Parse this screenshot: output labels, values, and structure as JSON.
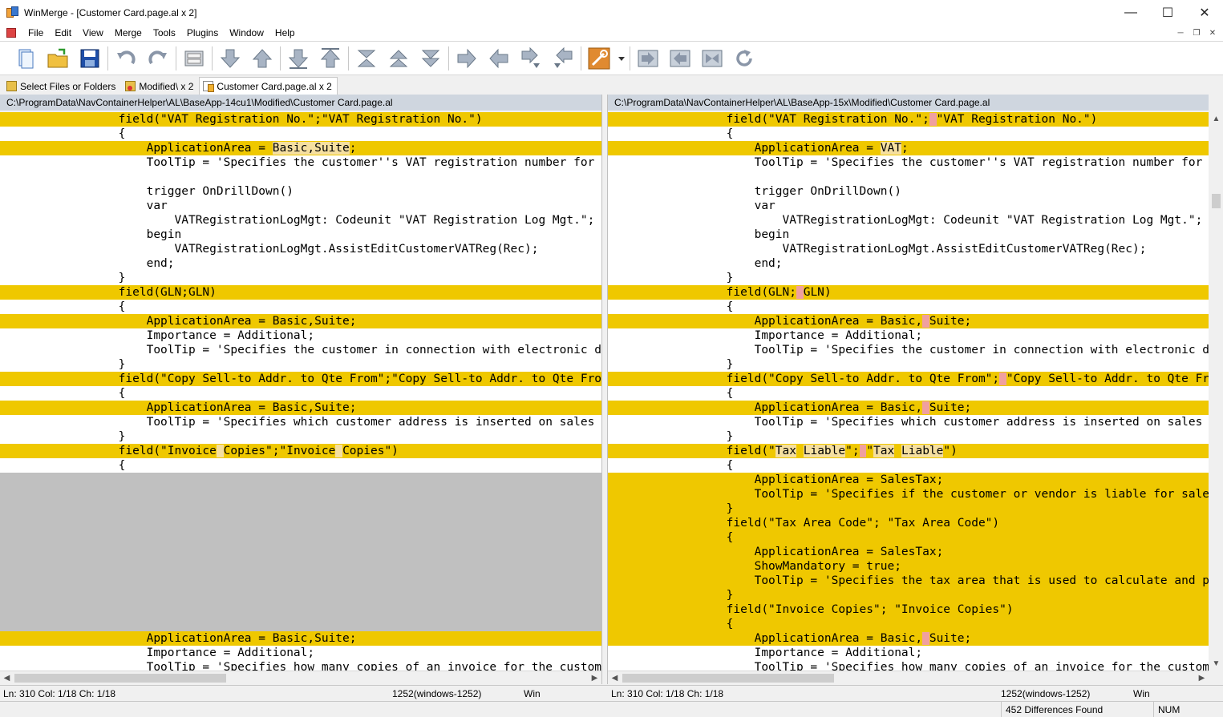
{
  "window": {
    "title": "WinMerge - [Customer Card.page.al x 2]"
  },
  "menu": [
    "File",
    "Edit",
    "View",
    "Merge",
    "Tools",
    "Plugins",
    "Window",
    "Help"
  ],
  "toolbar_icons": [
    "new-icon",
    "open-icon",
    "save-icon",
    "undo-icon",
    "redo-icon",
    "compare-icon",
    "next-diff-icon",
    "prev-diff-icon",
    "first-diff-icon",
    "last-diff-icon",
    "current-diff-icon",
    "prev-conflict-icon",
    "next-conflict-icon",
    "copy-right-icon",
    "copy-left-icon",
    "copy-right-advance-icon",
    "copy-left-advance-icon",
    "options-icon",
    "copy-all-right-icon",
    "copy-all-left-icon",
    "collapse-icon",
    "refresh-icon"
  ],
  "tabs": [
    {
      "label": "Select Files or Folders",
      "icon": "folder-icon",
      "active": false
    },
    {
      "label": "Modified\\ x 2",
      "icon": "folder-diff-icon",
      "active": false
    },
    {
      "label": "Customer Card.page.al x 2",
      "icon": "file-diff-icon",
      "active": true
    }
  ],
  "left": {
    "path": "C:\\ProgramData\\NavContainerHelper\\AL\\BaseApp-14cu1\\Modified\\Customer Card.page.al",
    "status": {
      "pos": "Ln: 310  Col: 1/18  Ch: 1/18",
      "encoding": "1252(windows-1252)",
      "eol": "Win"
    },
    "lines": [
      {
        "t": "diff",
        "segs": [
          {
            "s": "                field(\"VAT Registration No.\";\"VAT Registration No.\")"
          }
        ]
      },
      {
        "t": "",
        "segs": [
          {
            "s": "                {"
          }
        ]
      },
      {
        "t": "diff",
        "segs": [
          {
            "s": "                    ApplicationArea = "
          },
          {
            "s": "Basic,Suite",
            "h": "hl"
          },
          {
            "s": ";"
          }
        ]
      },
      {
        "t": "",
        "segs": [
          {
            "s": "                    ToolTip = 'Specifies the customer''s VAT registration number for customers in EU countries/regions.';"
          }
        ]
      },
      {
        "t": "",
        "segs": [
          {
            "s": ""
          }
        ]
      },
      {
        "t": "",
        "segs": [
          {
            "s": "                    trigger OnDrillDown()"
          }
        ]
      },
      {
        "t": "",
        "segs": [
          {
            "s": "                    var"
          }
        ]
      },
      {
        "t": "",
        "segs": [
          {
            "s": "                        VATRegistrationLogMgt: Codeunit \"VAT Registration Log Mgt.\";"
          }
        ]
      },
      {
        "t": "",
        "segs": [
          {
            "s": "                    begin"
          }
        ]
      },
      {
        "t": "",
        "segs": [
          {
            "s": "                        VATRegistrationLogMgt.AssistEditCustomerVATReg(Rec);"
          }
        ]
      },
      {
        "t": "",
        "segs": [
          {
            "s": "                    end;"
          }
        ]
      },
      {
        "t": "",
        "segs": [
          {
            "s": "                }"
          }
        ]
      },
      {
        "t": "diff",
        "segs": [
          {
            "s": "                field(GLN;GLN)"
          }
        ]
      },
      {
        "t": "",
        "segs": [
          {
            "s": "                {"
          }
        ]
      },
      {
        "t": "diff",
        "segs": [
          {
            "s": "                    ApplicationArea = Basic,Suite;"
          }
        ]
      },
      {
        "t": "",
        "segs": [
          {
            "s": "                    Importance = Additional;"
          }
        ]
      },
      {
        "t": "",
        "segs": [
          {
            "s": "                    ToolTip = 'Specifies the customer in connection with electronic document sending.';"
          }
        ]
      },
      {
        "t": "",
        "segs": [
          {
            "s": "                }"
          }
        ]
      },
      {
        "t": "diff",
        "segs": [
          {
            "s": "                field(\"Copy Sell-to Addr. to Qte From\";\"Copy Sell-to Addr. to Qte From\")"
          }
        ]
      },
      {
        "t": "",
        "segs": [
          {
            "s": "                {"
          }
        ]
      },
      {
        "t": "diff",
        "segs": [
          {
            "s": "                    ApplicationArea = Basic,Suite;"
          }
        ]
      },
      {
        "t": "",
        "segs": [
          {
            "s": "                    ToolTip = 'Specifies which customer address is inserted on sales quotes that you create for the customer.';"
          }
        ]
      },
      {
        "t": "",
        "segs": [
          {
            "s": "                }"
          }
        ]
      },
      {
        "t": "diff",
        "segs": [
          {
            "s": "                field(\"Invoice"
          },
          {
            "s": " ",
            "h": "hl"
          },
          {
            "s": "Copies\";\"Invoice"
          },
          {
            "s": " ",
            "h": "hl"
          },
          {
            "s": "Copies\")"
          }
        ]
      },
      {
        "t": "",
        "segs": [
          {
            "s": "                {"
          }
        ]
      },
      {
        "t": "blank",
        "segs": [
          {
            "s": ""
          }
        ]
      },
      {
        "t": "blank",
        "segs": [
          {
            "s": ""
          }
        ]
      },
      {
        "t": "blank",
        "segs": [
          {
            "s": ""
          }
        ]
      },
      {
        "t": "blank",
        "segs": [
          {
            "s": ""
          }
        ]
      },
      {
        "t": "blank",
        "segs": [
          {
            "s": ""
          }
        ]
      },
      {
        "t": "blank",
        "segs": [
          {
            "s": ""
          }
        ]
      },
      {
        "t": "blank",
        "segs": [
          {
            "s": ""
          }
        ]
      },
      {
        "t": "blank",
        "segs": [
          {
            "s": ""
          }
        ]
      },
      {
        "t": "blank",
        "segs": [
          {
            "s": ""
          }
        ]
      },
      {
        "t": "blank",
        "segs": [
          {
            "s": ""
          }
        ]
      },
      {
        "t": "blank",
        "segs": [
          {
            "s": ""
          }
        ]
      },
      {
        "t": "diff",
        "segs": [
          {
            "s": "                    ApplicationArea = Basic,Suite;"
          }
        ]
      },
      {
        "t": "",
        "segs": [
          {
            "s": "                    Importance = Additional;"
          }
        ]
      },
      {
        "t": "",
        "segs": [
          {
            "s": "                    ToolTip = 'Specifies how many copies of an invoice for the customer will be printed at a time.';"
          }
        ]
      }
    ]
  },
  "right": {
    "path": "C:\\ProgramData\\NavContainerHelper\\AL\\BaseApp-15x\\Modified\\Customer Card.page.al",
    "status": {
      "pos": "Ln: 310  Col: 1/18  Ch: 1/18",
      "encoding": "1252(windows-1252)",
      "eol": "Win"
    },
    "lines": [
      {
        "t": "diff",
        "segs": [
          {
            "s": "                field(\"VAT Registration No.\";"
          },
          {
            "s": " ",
            "h": "hl2"
          },
          {
            "s": "\"VAT Registration No.\")"
          }
        ]
      },
      {
        "t": "",
        "segs": [
          {
            "s": "                {"
          }
        ]
      },
      {
        "t": "diff",
        "segs": [
          {
            "s": "                    ApplicationArea = "
          },
          {
            "s": "VAT",
            "h": "hl"
          },
          {
            "s": ";"
          }
        ]
      },
      {
        "t": "",
        "segs": [
          {
            "s": "                    ToolTip = 'Specifies the customer''s VAT registration number for customers in EU countries/regions.';"
          }
        ]
      },
      {
        "t": "",
        "segs": [
          {
            "s": ""
          }
        ]
      },
      {
        "t": "",
        "segs": [
          {
            "s": "                    trigger OnDrillDown()"
          }
        ]
      },
      {
        "t": "",
        "segs": [
          {
            "s": "                    var"
          }
        ]
      },
      {
        "t": "",
        "segs": [
          {
            "s": "                        VATRegistrationLogMgt: Codeunit \"VAT Registration Log Mgt.\";"
          }
        ]
      },
      {
        "t": "",
        "segs": [
          {
            "s": "                    begin"
          }
        ]
      },
      {
        "t": "",
        "segs": [
          {
            "s": "                        VATRegistrationLogMgt.AssistEditCustomerVATReg(Rec);"
          }
        ]
      },
      {
        "t": "",
        "segs": [
          {
            "s": "                    end;"
          }
        ]
      },
      {
        "t": "",
        "segs": [
          {
            "s": "                }"
          }
        ]
      },
      {
        "t": "diff",
        "segs": [
          {
            "s": "                field(GLN;"
          },
          {
            "s": " ",
            "h": "hl2"
          },
          {
            "s": "GLN)"
          }
        ]
      },
      {
        "t": "",
        "segs": [
          {
            "s": "                {"
          }
        ]
      },
      {
        "t": "diff",
        "segs": [
          {
            "s": "                    ApplicationArea = Basic,"
          },
          {
            "s": " ",
            "h": "hl2"
          },
          {
            "s": "Suite;"
          }
        ]
      },
      {
        "t": "",
        "segs": [
          {
            "s": "                    Importance = Additional;"
          }
        ]
      },
      {
        "t": "",
        "segs": [
          {
            "s": "                    ToolTip = 'Specifies the customer in connection with electronic document sending.';"
          }
        ]
      },
      {
        "t": "",
        "segs": [
          {
            "s": "                }"
          }
        ]
      },
      {
        "t": "diff",
        "segs": [
          {
            "s": "                field(\"Copy Sell-to Addr. to Qte From\";"
          },
          {
            "s": " ",
            "h": "hl2"
          },
          {
            "s": "\"Copy Sell-to Addr. to Qte From\")"
          }
        ]
      },
      {
        "t": "",
        "segs": [
          {
            "s": "                {"
          }
        ]
      },
      {
        "t": "diff",
        "segs": [
          {
            "s": "                    ApplicationArea = Basic,"
          },
          {
            "s": " ",
            "h": "hl2"
          },
          {
            "s": "Suite;"
          }
        ]
      },
      {
        "t": "",
        "segs": [
          {
            "s": "                    ToolTip = 'Specifies which customer address is inserted on sales quotes that you create for the customer.';"
          }
        ]
      },
      {
        "t": "",
        "segs": [
          {
            "s": "                }"
          }
        ]
      },
      {
        "t": "diff",
        "segs": [
          {
            "s": "                field(\""
          },
          {
            "s": "Tax",
            "h": "hl"
          },
          {
            "s": " "
          },
          {
            "s": "Liable",
            "h": "hl"
          },
          {
            "s": "\";"
          },
          {
            "s": " ",
            "h": "hl2"
          },
          {
            "s": "\""
          },
          {
            "s": "Tax",
            "h": "hl"
          },
          {
            "s": " "
          },
          {
            "s": "Liable",
            "h": "hl"
          },
          {
            "s": "\")"
          }
        ]
      },
      {
        "t": "",
        "segs": [
          {
            "s": "                {"
          }
        ]
      },
      {
        "t": "diff",
        "segs": [
          {
            "s": "                    ApplicationArea = SalesTax;"
          }
        ]
      },
      {
        "t": "diff",
        "segs": [
          {
            "s": "                    ToolTip = 'Specifies if the customer or vendor is liable for sales tax.';"
          }
        ]
      },
      {
        "t": "diff",
        "segs": [
          {
            "s": "                }"
          }
        ]
      },
      {
        "t": "diff",
        "segs": [
          {
            "s": "                field(\"Tax Area Code\"; \"Tax Area Code\")"
          }
        ]
      },
      {
        "t": "diff",
        "segs": [
          {
            "s": "                {"
          }
        ]
      },
      {
        "t": "diff",
        "segs": [
          {
            "s": "                    ApplicationArea = SalesTax;"
          }
        ]
      },
      {
        "t": "diff",
        "segs": [
          {
            "s": "                    ShowMandatory = true;"
          }
        ]
      },
      {
        "t": "diff",
        "segs": [
          {
            "s": "                    ToolTip = 'Specifies the tax area that is used to calculate and post sales tax.';"
          }
        ]
      },
      {
        "t": "diff",
        "segs": [
          {
            "s": "                }"
          }
        ]
      },
      {
        "t": "diff",
        "segs": [
          {
            "s": "                field(\"Invoice Copies\"; \"Invoice Copies\")"
          }
        ]
      },
      {
        "t": "diff",
        "segs": [
          {
            "s": "                {"
          }
        ]
      },
      {
        "t": "diff",
        "segs": [
          {
            "s": "                    ApplicationArea = Basic,"
          },
          {
            "s": " ",
            "h": "hl2"
          },
          {
            "s": "Suite;"
          }
        ]
      },
      {
        "t": "",
        "segs": [
          {
            "s": "                    Importance = Additional;"
          }
        ]
      },
      {
        "t": "",
        "segs": [
          {
            "s": "                    ToolTip = 'Specifies how many copies of an invoice for the customer will be printed at a time.';"
          }
        ]
      }
    ]
  },
  "status": {
    "differences": "452 Differences Found",
    "num": "NUM"
  }
}
